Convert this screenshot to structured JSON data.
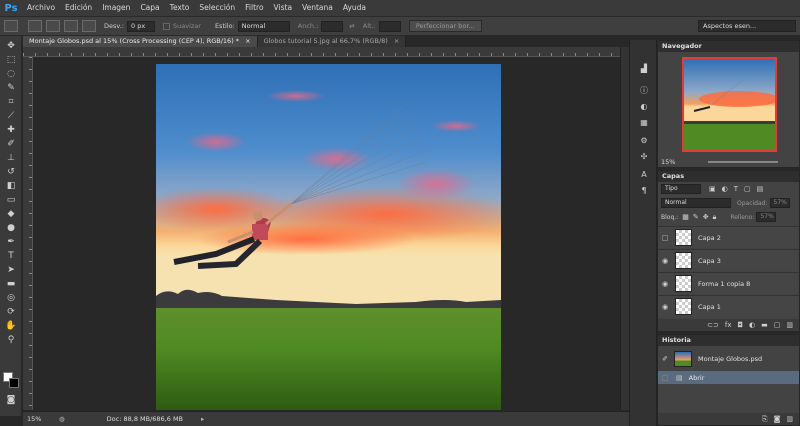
{
  "app": {
    "logo": "Ps"
  },
  "menu": [
    "Archivo",
    "Edición",
    "Imagen",
    "Capa",
    "Texto",
    "Selección",
    "Filtro",
    "Vista",
    "Ventana",
    "Ayuda"
  ],
  "options": {
    "feather_label": "Desv.:",
    "feather_value": "0 px",
    "smooth_label": "Suavizar",
    "style_label": "Estilo:",
    "style_value": "Normal",
    "width_label": "Anch.:",
    "height_label": "Alt.:",
    "refine_button": "Perfeccionar bor...",
    "workspace": "Aspectos esen..."
  },
  "tabs": [
    {
      "label": "Montaje Globos.psd al 15% (Cross Processing (CEP 4), RGB/16) *",
      "active": true
    },
    {
      "label": "Globos tutorial 5.jpg al 66,7% (RGB/8)",
      "active": false
    }
  ],
  "status": {
    "zoom": "15%",
    "doc": "Doc: 88,8 MB/686,6 MB"
  },
  "navigator": {
    "title": "Navegador",
    "zoom": "15%"
  },
  "layers": {
    "title": "Capas",
    "filter": "Tipo",
    "blend": "Normal",
    "opacity_label": "Opacidad:",
    "opacity_value": "57%",
    "lock_label": "Bloq.:",
    "fill_label": "Relleno:",
    "fill_value": "57%",
    "items": [
      {
        "name": "Capa 2",
        "visible": false
      },
      {
        "name": "Capa 3",
        "visible": true
      },
      {
        "name": "Forma 1 copia 8",
        "visible": true
      },
      {
        "name": "Capa 1",
        "visible": true
      }
    ]
  },
  "history": {
    "title": "Historia",
    "snapshot": "Montaje Globos.psd",
    "items": [
      "Abrir"
    ]
  },
  "colors": {
    "accent": "#33a7ff",
    "nav_frame": "#e53a3a",
    "panel_bg": "#434343"
  }
}
